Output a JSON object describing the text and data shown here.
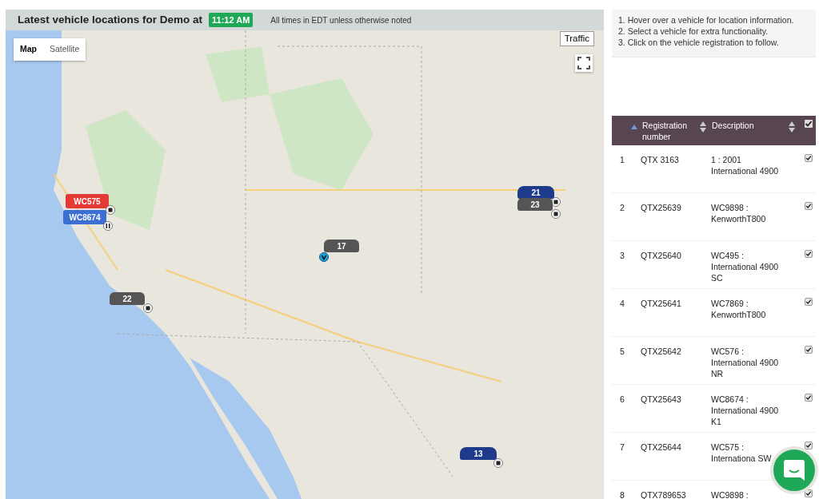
{
  "header": {
    "title": "Latest vehicle locations for Demo at",
    "time": "11:12 AM",
    "note": "All times in EDT unless otherwise noted"
  },
  "map": {
    "map_types": [
      {
        "label": "Map",
        "selected": true
      },
      {
        "label": "Satellite",
        "selected": false
      }
    ],
    "traffic": "Traffic",
    "vehicles": [
      {
        "kind": "truck",
        "label": "WC575",
        "color": "#e53935",
        "status_icon": {
          "kind": "stop"
        }
      },
      {
        "kind": "truck",
        "label": "WC8674",
        "color": "#3b6fd4",
        "status_icon": {
          "kind": "pause"
        }
      },
      {
        "kind": "car",
        "label": "22",
        "color": "#555555",
        "status_icon": {
          "kind": "stop"
        }
      },
      {
        "kind": "car",
        "label": "17",
        "color": "#555555",
        "status_icon": {
          "kind": "direction"
        }
      },
      {
        "kind": "van",
        "label": "21",
        "color": "#1e3a8a",
        "status_icon": {
          "kind": "stop"
        }
      },
      {
        "kind": "car",
        "label": "23",
        "color": "#555555",
        "status_icon": {
          "kind": "stop"
        }
      },
      {
        "kind": "van",
        "label": "13",
        "color": "#1e3a8a",
        "status_icon": {
          "kind": "stop"
        }
      }
    ]
  },
  "instructions": [
    "1. Hover over a vehicle for location information.",
    "2. Select a vehicle for extra functionality.",
    "3. Click on the vehicle registration to follow."
  ],
  "table": {
    "columns": [
      "Registration number",
      "Description"
    ],
    "select_all_checked": true,
    "rows": [
      {
        "index": "1",
        "registration": "QTX 3163",
        "description": "1 : 2001 International 4900",
        "checked": true
      },
      {
        "index": "2",
        "registration": "QTX25639",
        "description": "WC9898 : KenworthT800",
        "checked": true
      },
      {
        "index": "3",
        "registration": "QTX25640",
        "description": "WC495 : International 4900 SC",
        "checked": true
      },
      {
        "index": "4",
        "registration": "QTX25641",
        "description": "WC7869 : KenworthT800",
        "checked": true
      },
      {
        "index": "5",
        "registration": "QTX25642",
        "description": "WC576 : International 4900 NR",
        "checked": true
      },
      {
        "index": "6",
        "registration": "QTX25643",
        "description": "WC8674 : International 4900 K1",
        "checked": true
      },
      {
        "index": "7",
        "registration": "QTX25644",
        "description": "WC575 : Internationa SW",
        "checked": true
      },
      {
        "index": "8",
        "registration": "QTX789653",
        "description": "WC9898 :",
        "checked": true
      }
    ]
  }
}
